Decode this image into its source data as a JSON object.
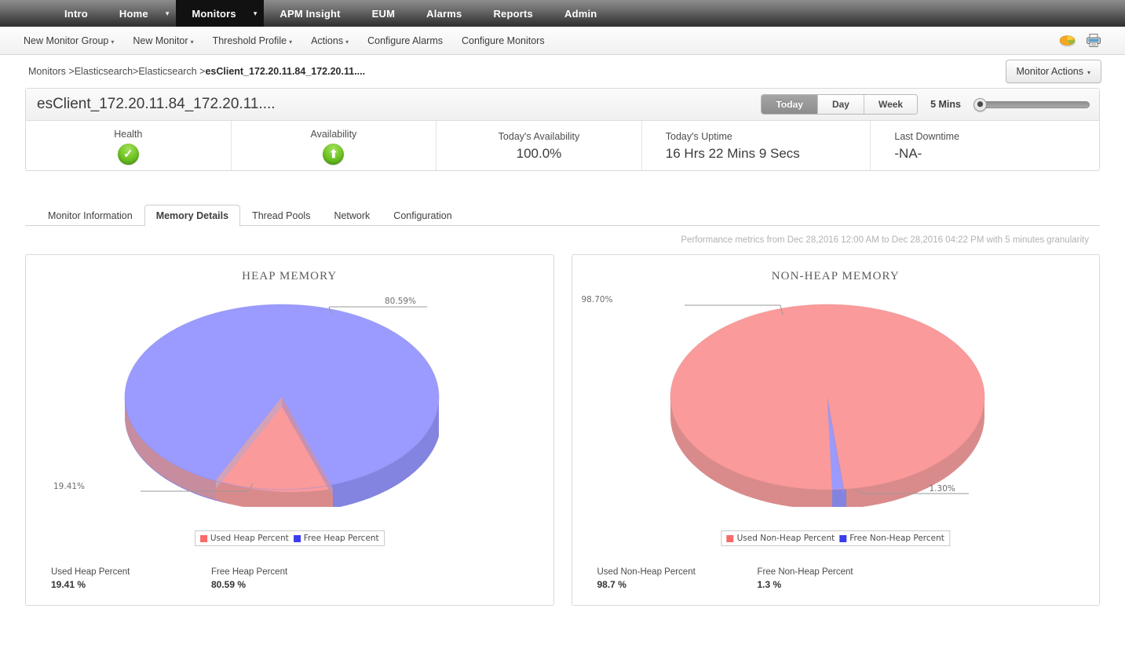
{
  "topnav": {
    "items": [
      {
        "label": "Intro",
        "caret": false,
        "active": false
      },
      {
        "label": "Home",
        "caret": true,
        "active": false
      },
      {
        "label": "Monitors",
        "caret": true,
        "active": true
      },
      {
        "label": "APM Insight",
        "caret": false,
        "active": false
      },
      {
        "label": "EUM",
        "caret": false,
        "active": false
      },
      {
        "label": "Alarms",
        "caret": false,
        "active": false
      },
      {
        "label": "Reports",
        "caret": false,
        "active": false
      },
      {
        "label": "Admin",
        "caret": false,
        "active": false
      }
    ]
  },
  "subnav": {
    "items": [
      {
        "label": "New Monitor Group",
        "caret": true
      },
      {
        "label": "New Monitor",
        "caret": true
      },
      {
        "label": "Threshold Profile",
        "caret": true
      },
      {
        "label": "Actions",
        "caret": true
      },
      {
        "label": "Configure Alarms",
        "caret": false
      },
      {
        "label": "Configure Monitors",
        "caret": false
      }
    ],
    "icons": [
      "pie-chart-icon",
      "printer-icon"
    ]
  },
  "breadcrumb": {
    "prefix": "Monitors >Elasticsearch>Elasticsearch >",
    "current": "esClient_172.20.11.84_172.20.11....",
    "monitor_actions_label": "Monitor Actions"
  },
  "summary": {
    "title": "esClient_172.20.11.84_172.20.11....",
    "period_options": [
      "Today",
      "Day",
      "Week"
    ],
    "period_selected": "Today",
    "granularity": "5 Mins",
    "stats": [
      {
        "label": "Health",
        "value": "",
        "icon": "health-check-icon"
      },
      {
        "label": "Availability",
        "value": "",
        "icon": "availability-up-icon"
      },
      {
        "label": "Today's Availability",
        "value": "100.0%",
        "icon": ""
      },
      {
        "label": "Today's Uptime",
        "value": "16 Hrs 22 Mins 9 Secs",
        "icon": ""
      },
      {
        "label": "Last Downtime",
        "value": "-NA-",
        "icon": ""
      }
    ]
  },
  "tabs": {
    "items": [
      {
        "label": "Monitor Information",
        "selected": false
      },
      {
        "label": "Memory Details",
        "selected": true
      },
      {
        "label": "Thread Pools",
        "selected": false
      },
      {
        "label": "Network",
        "selected": false
      },
      {
        "label": "Configuration",
        "selected": false
      }
    ]
  },
  "metrics_note": "Performance metrics from Dec 28,2016 12:00 AM to Dec 28,2016 04:22 PM with 5 minutes granularity",
  "colors": {
    "used": "#fb9a9a",
    "free": "#9a9aff",
    "used_side": "#d98b8b",
    "free_side": "#8383e0"
  },
  "chart_data": [
    {
      "type": "pie",
      "title": "HEAP MEMORY",
      "categories": [
        "Used Heap Percent",
        "Free Heap Percent"
      ],
      "values": [
        19.41,
        80.59
      ],
      "labels": [
        "19.41%",
        "80.59%"
      ],
      "colors": [
        "#fb9a9a",
        "#9a9aff"
      ],
      "legend": [
        "Used Heap Percent",
        "Free Heap Percent"
      ],
      "legend_position": "bottom",
      "summary": [
        {
          "label": "Used Heap Percent",
          "value": "19.41 %"
        },
        {
          "label": "Free Heap Percent",
          "value": "80.59 %"
        }
      ]
    },
    {
      "type": "pie",
      "title": "NON-HEAP MEMORY",
      "categories": [
        "Used Non-Heap Percent",
        "Free Non-Heap Percent"
      ],
      "values": [
        98.7,
        1.3
      ],
      "labels": [
        "98.70%",
        "1.30%"
      ],
      "colors": [
        "#fb9a9a",
        "#9a9aff"
      ],
      "legend": [
        "Used Non-Heap Percent",
        "Free Non-Heap Percent"
      ],
      "legend_position": "bottom",
      "summary": [
        {
          "label": "Used Non-Heap Percent",
          "value": "98.7 %"
        },
        {
          "label": "Free Non-Heap Percent",
          "value": "1.3 %"
        }
      ]
    }
  ]
}
